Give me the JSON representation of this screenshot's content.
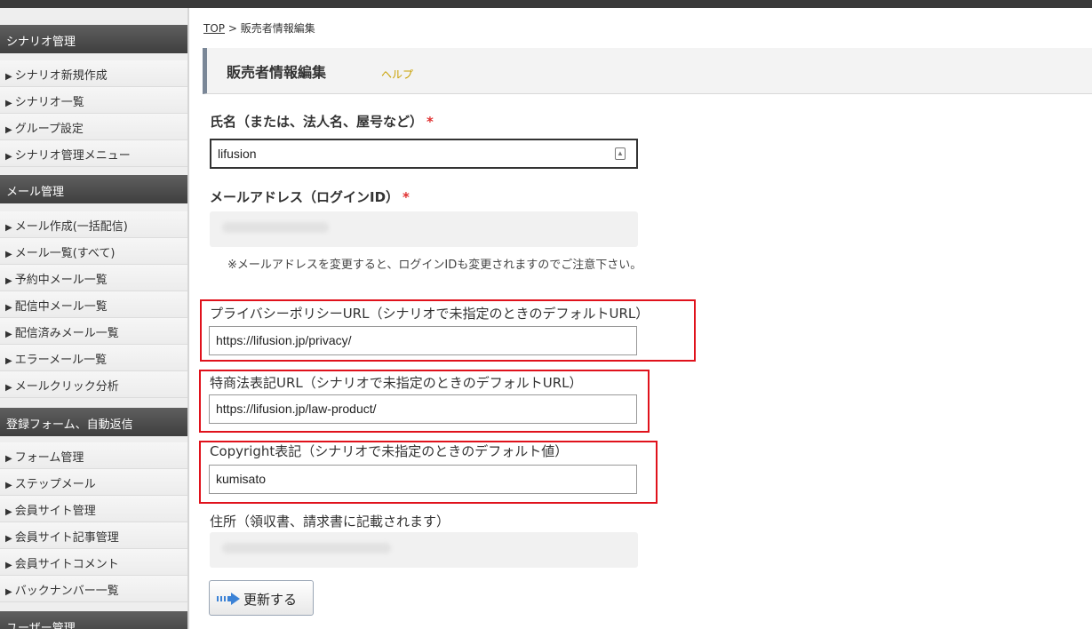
{
  "sidebar": {
    "sections": [
      {
        "title": "シナリオ管理",
        "items": [
          "シナリオ新規作成",
          "シナリオ一覧",
          "グループ設定",
          "シナリオ管理メニュー"
        ]
      },
      {
        "title": "メール管理",
        "items": [
          "メール作成(一括配信)",
          "メール一覧(すべて)",
          "予約中メール一覧",
          "配信中メール一覧",
          "配信済みメール一覧",
          "エラーメール一覧",
          "メールクリック分析"
        ]
      },
      {
        "title": "登録フォーム、自動返信",
        "items": [
          "フォーム管理",
          "ステップメール",
          "会員サイト管理",
          "会員サイト記事管理",
          "会員サイトコメント",
          "バックナンバー一覧"
        ]
      },
      {
        "title": "ユーザー管理",
        "items": []
      }
    ],
    "bullet": "▶"
  },
  "breadcrumb": {
    "top": "TOP",
    "separator": ">",
    "current": "販売者情報編集"
  },
  "page": {
    "title": "販売者情報編集",
    "help": "ヘルプ"
  },
  "form": {
    "name": {
      "label": "氏名（または、法人名、屋号など）",
      "required": "*",
      "value": "lifusion"
    },
    "email": {
      "label": "メールアドレス（ログインID）",
      "required": "*",
      "note": "※メールアドレスを変更すると、ログインIDも変更されますのでご注意下さい。"
    },
    "privacy_url": {
      "label": "プライバシーポリシーURL（シナリオで未指定のときのデフォルトURL）",
      "value": "https://lifusion.jp/privacy/"
    },
    "law_url": {
      "label": "特商法表記URL（シナリオで未指定のときのデフォルトURL）",
      "value": "https://lifusion.jp/law-product/"
    },
    "copyright": {
      "label": "Copyright表記（シナリオで未指定のときのデフォルト値）",
      "value": "kumisato"
    },
    "address": {
      "label": "住所（領収書、請求書に記載されます）"
    },
    "submit": "更新する"
  },
  "colors": {
    "highlight": "#e0121c",
    "required": "#e03030",
    "help": "#c8a000",
    "sidebar_header": "#4a4a4a"
  }
}
